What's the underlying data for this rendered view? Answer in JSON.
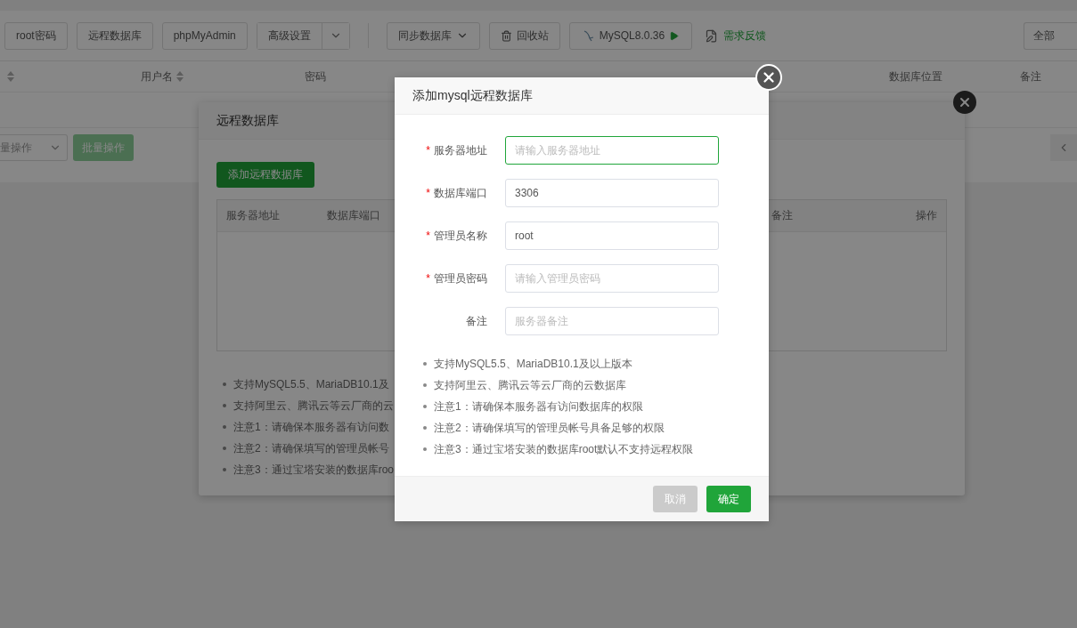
{
  "toolbar": {
    "items": [
      {
        "kind": "button",
        "label": "root密码"
      },
      {
        "kind": "button",
        "label": "远程数据库"
      },
      {
        "kind": "button",
        "label": "phpMyAdmin"
      },
      {
        "kind": "split",
        "label": "高级设置"
      },
      {
        "kind": "divider"
      },
      {
        "kind": "dropdown",
        "label": "同步数据库"
      },
      {
        "kind": "trash",
        "label": "回收站"
      },
      {
        "kind": "version",
        "label": "MySQL8.0.36"
      },
      {
        "kind": "link",
        "label": "需求反馈"
      }
    ],
    "filter": "全部"
  },
  "table": {
    "columns": [
      {
        "kind": "sortable"
      },
      {
        "kind": "sortable",
        "label": "用户名"
      },
      {
        "kind": "plain",
        "label": "密码"
      },
      {
        "kind": "plain",
        "label": "数据库位置"
      },
      {
        "kind": "plain",
        "label": "备注"
      }
    ]
  },
  "batch": {
    "select": "量操作",
    "button": "批量操作"
  },
  "remote_dialog": {
    "title": "远程数据库",
    "add_button": "添加远程数据库",
    "columns": [
      "服务器地址",
      "数据库端口",
      "备注",
      "操作"
    ],
    "notes": [
      "支持MySQL5.5、MariaDB10.1及",
      "支持阿里云、腾讯云等云厂商的云",
      "注意1：请确保本服务器有访问数",
      "注意2：请确保填写的管理员帐号",
      "注意3：通过宝塔安装的数据库roo"
    ]
  },
  "add_dialog": {
    "title": "添加mysql远程数据库",
    "fields": [
      {
        "label": "服务器地址",
        "required_mark": "*",
        "placeholder": "请输入服务器地址",
        "focused": true
      },
      {
        "label": "数据库端口",
        "required_mark": "*",
        "value": "3306",
        "focused": false
      },
      {
        "label": "管理员名称",
        "required_mark": "*",
        "value": "root",
        "focused": false
      },
      {
        "label": "管理员密码",
        "required_mark": "*",
        "placeholder": "请输入管理员密码",
        "focused": false
      },
      {
        "label": "备注",
        "placeholder": "服务器备注",
        "focused": false
      }
    ],
    "notes": [
      "支持MySQL5.5、MariaDB10.1及以上版本",
      "支持阿里云、腾讯云等云厂商的云数据库",
      "注意1：请确保本服务器有访问数据库的权限",
      "注意2：请确保填写的管理员帐号具备足够的权限",
      "注意3：通过宝塔安装的数据库root默认不支持远程权限"
    ],
    "buttons": [
      {
        "kind": "cancel",
        "label": "取消"
      },
      {
        "kind": "primary",
        "label": "确定"
      }
    ]
  }
}
